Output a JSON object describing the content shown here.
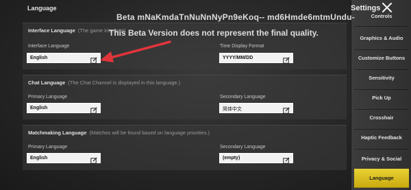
{
  "header": {
    "section_title": "Language",
    "settings_title": "Settings",
    "beta_line1": "Beta mNaKmdaTnNuNnNyPn9eKoq-- md6Hmde6mtmUndu-",
    "beta_line2": "This Beta Version does not represent the final quality."
  },
  "interface": {
    "title": "Interface Language",
    "hint": "(The game interface)",
    "language_label": "Interface Language",
    "language_value": "English",
    "time_label": "Time Display Format",
    "time_value": "YYYY/MM/DD"
  },
  "chat": {
    "title": "Chat Language",
    "hint": "(The Chat Channel is displayed in this language.)",
    "primary_label": "Primary Language",
    "primary_value": "English",
    "secondary_label": "Secondary Language",
    "secondary_value": "简体中文"
  },
  "matchmaking": {
    "title": "Matchmaking Language",
    "hint": "(Matches will be found based on language priorities.)",
    "primary_label": "Primary Language",
    "primary_value": "English",
    "secondary_label": "Secondary Language",
    "secondary_value": "(empty)"
  },
  "sidebar": {
    "items": [
      {
        "label": "Controls"
      },
      {
        "label": "Graphics & Audio"
      },
      {
        "label": "Customize Buttons"
      },
      {
        "label": "Sensitivity"
      },
      {
        "label": "Pick Up"
      },
      {
        "label": "Crosshair"
      },
      {
        "label": "Haptic Feedback"
      },
      {
        "label": "Privacy & Social"
      },
      {
        "label": "Language"
      }
    ],
    "active_index": 8
  },
  "colors": {
    "accent": "#e0c425",
    "arrow": "#e0343b"
  }
}
